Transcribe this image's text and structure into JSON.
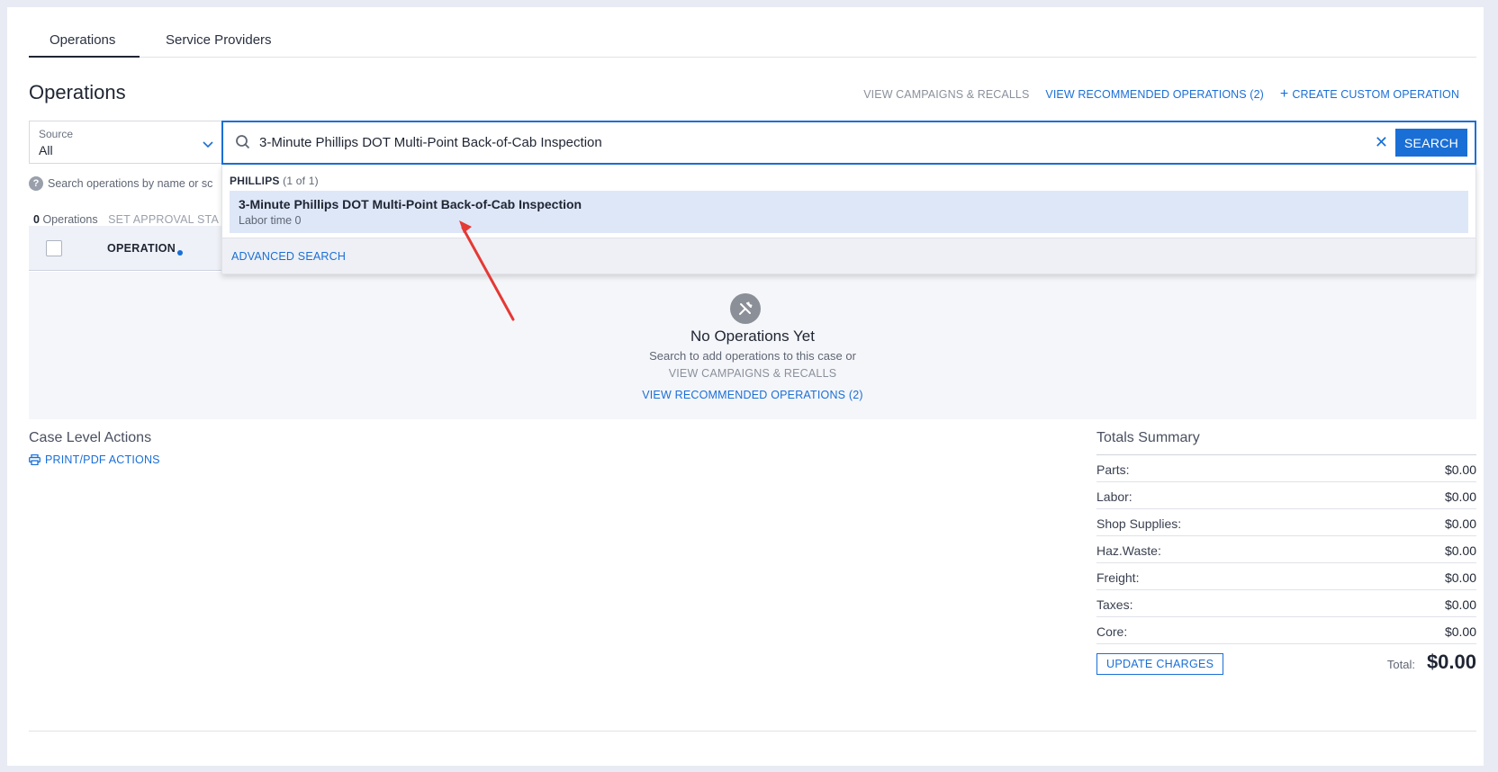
{
  "tabs": [
    {
      "label": "Operations",
      "active": true
    },
    {
      "label": "Service Providers",
      "active": false
    }
  ],
  "page_title": "Operations",
  "top_actions": {
    "campaigns": "VIEW CAMPAIGNS & RECALLS",
    "recommended": "VIEW RECOMMENDED OPERATIONS (2)",
    "create": "CREATE CUSTOM OPERATION"
  },
  "source": {
    "label": "Source",
    "value": "All"
  },
  "search": {
    "value": "3-Minute Phillips DOT Multi-Point Back-of-Cab Inspection",
    "button": "SEARCH",
    "hint": "Search operations by name or sc"
  },
  "dropdown": {
    "group": "PHILLIPS",
    "group_count": "(1 of 1)",
    "result_title": "3-Minute Phillips DOT Multi-Point Back-of-Cab Inspection",
    "result_sub": "Labor time 0",
    "advanced": "ADVANCED SEARCH"
  },
  "ops_bar": {
    "count": "0",
    "label": "Operations",
    "set_approval": "SET APPROVAL STA"
  },
  "table": {
    "col_operation": "OPERATION"
  },
  "empty": {
    "title": "No Operations Yet",
    "sub": "Search to add operations to this case or",
    "campaigns": "VIEW CAMPAIGNS & RECALLS",
    "recommended": "VIEW RECOMMENDED OPERATIONS (2)"
  },
  "case": {
    "title": "Case Level Actions",
    "print": "PRINT/PDF ACTIONS"
  },
  "totals": {
    "title": "Totals Summary",
    "rows": [
      {
        "label": "Parts:",
        "value": "$0.00"
      },
      {
        "label": "Labor:",
        "value": "$0.00"
      },
      {
        "label": "Shop Supplies:",
        "value": "$0.00"
      },
      {
        "label": "Haz.Waste:",
        "value": "$0.00"
      },
      {
        "label": "Freight:",
        "value": "$0.00"
      },
      {
        "label": "Taxes:",
        "value": "$0.00"
      },
      {
        "label": "Core:",
        "value": "$0.00"
      }
    ],
    "update_button": "UPDATE CHARGES",
    "total_label": "Total:",
    "total_value": "$0.00"
  },
  "colors": {
    "accent": "#1a6fd6",
    "highlight": "#dde7f7",
    "arrow": "#e53935"
  }
}
